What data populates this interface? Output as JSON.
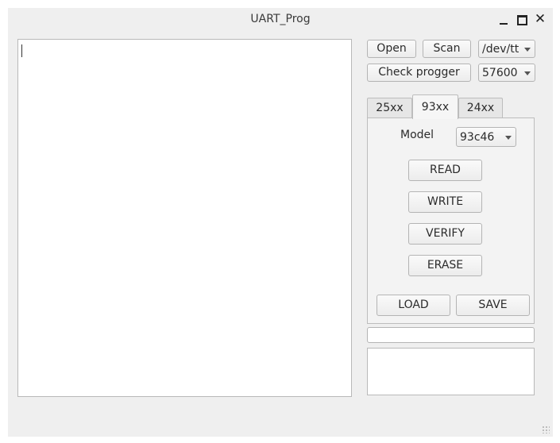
{
  "window": {
    "title": "UART_Prog"
  },
  "editor": {
    "text": ""
  },
  "serial": {
    "open_label": "Open",
    "scan_label": "Scan",
    "port_value": "/dev/tt",
    "check_label": "Check progger",
    "baud_value": "57600"
  },
  "tabs": [
    {
      "label": "25xx",
      "active": false
    },
    {
      "label": "93xx",
      "active": true
    },
    {
      "label": "24xx",
      "active": false
    }
  ],
  "panel_93xx": {
    "model_label": "Model",
    "model_value": "93c46",
    "read_label": "READ",
    "write_label": "WRITE",
    "verify_label": "VERIFY",
    "erase_label": "ERASE",
    "load_label": "LOAD",
    "save_label": "SAVE"
  },
  "progress": {
    "value": 0
  },
  "status_log": {
    "text": ""
  }
}
